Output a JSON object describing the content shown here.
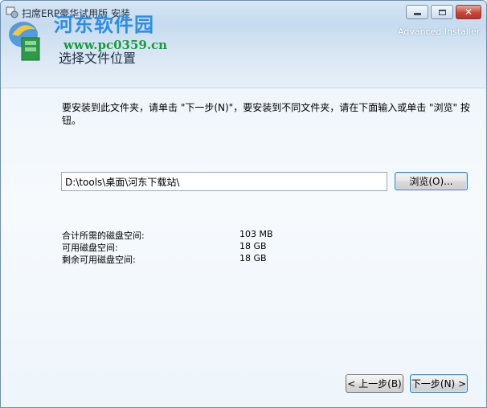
{
  "window": {
    "title": "扫席ERP豪华试用版 安装"
  },
  "watermark": {
    "name": "河东软件园",
    "url": "www.pc0359.cn"
  },
  "header": {
    "heading": "选择文件位置",
    "brand": "Advanced Installer"
  },
  "instruction": "要安装到此文件夹，请单击 \"下一步(N)\"，要安装到不同文件夹，请在下面输入或单击 \"浏览\" 按钮。",
  "install_path": {
    "value": "D:\\tools\\桌面\\河东下载站\\"
  },
  "browse_label": "浏览(O)...",
  "disk_space": [
    {
      "label": "合计所需的磁盘空间:",
      "value": "103 MB"
    },
    {
      "label": "可用磁盘空间:",
      "value": "18 GB"
    },
    {
      "label": "剩余可用磁盘空间:",
      "value": "18 GB"
    }
  ],
  "nav": {
    "back_label": "< 上一步(B)",
    "next_label": "下一步(N) >"
  },
  "colors": {
    "accent": "#3c7fb1",
    "titlebar": "#c6dbee",
    "close": "#c8473a"
  }
}
